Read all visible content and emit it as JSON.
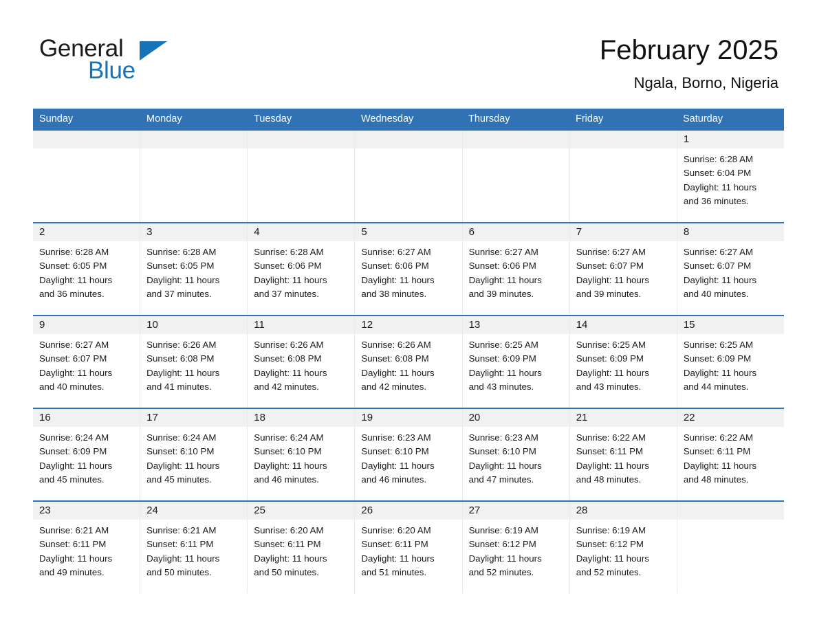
{
  "brand": {
    "name_part1": "General",
    "name_part2": "Blue",
    "triangle_color": "#1673b8"
  },
  "header": {
    "title": "February 2025",
    "subtitle": "Ngala, Borno, Nigeria"
  },
  "colors": {
    "header_blue": "#3072b4",
    "daynum_band": "#f1f1f1",
    "text": "#1b1b1b"
  },
  "weekday_headers": [
    "Sunday",
    "Monday",
    "Tuesday",
    "Wednesday",
    "Thursday",
    "Friday",
    "Saturday"
  ],
  "weeks": [
    [
      {
        "day": "",
        "lines": []
      },
      {
        "day": "",
        "lines": []
      },
      {
        "day": "",
        "lines": []
      },
      {
        "day": "",
        "lines": []
      },
      {
        "day": "",
        "lines": []
      },
      {
        "day": "",
        "lines": []
      },
      {
        "day": "1",
        "lines": [
          "Sunrise: 6:28 AM",
          "Sunset: 6:04 PM",
          "Daylight: 11 hours",
          "and 36 minutes."
        ]
      }
    ],
    [
      {
        "day": "2",
        "lines": [
          "Sunrise: 6:28 AM",
          "Sunset: 6:05 PM",
          "Daylight: 11 hours",
          "and 36 minutes."
        ]
      },
      {
        "day": "3",
        "lines": [
          "Sunrise: 6:28 AM",
          "Sunset: 6:05 PM",
          "Daylight: 11 hours",
          "and 37 minutes."
        ]
      },
      {
        "day": "4",
        "lines": [
          "Sunrise: 6:28 AM",
          "Sunset: 6:06 PM",
          "Daylight: 11 hours",
          "and 37 minutes."
        ]
      },
      {
        "day": "5",
        "lines": [
          "Sunrise: 6:27 AM",
          "Sunset: 6:06 PM",
          "Daylight: 11 hours",
          "and 38 minutes."
        ]
      },
      {
        "day": "6",
        "lines": [
          "Sunrise: 6:27 AM",
          "Sunset: 6:06 PM",
          "Daylight: 11 hours",
          "and 39 minutes."
        ]
      },
      {
        "day": "7",
        "lines": [
          "Sunrise: 6:27 AM",
          "Sunset: 6:07 PM",
          "Daylight: 11 hours",
          "and 39 minutes."
        ]
      },
      {
        "day": "8",
        "lines": [
          "Sunrise: 6:27 AM",
          "Sunset: 6:07 PM",
          "Daylight: 11 hours",
          "and 40 minutes."
        ]
      }
    ],
    [
      {
        "day": "9",
        "lines": [
          "Sunrise: 6:27 AM",
          "Sunset: 6:07 PM",
          "Daylight: 11 hours",
          "and 40 minutes."
        ]
      },
      {
        "day": "10",
        "lines": [
          "Sunrise: 6:26 AM",
          "Sunset: 6:08 PM",
          "Daylight: 11 hours",
          "and 41 minutes."
        ]
      },
      {
        "day": "11",
        "lines": [
          "Sunrise: 6:26 AM",
          "Sunset: 6:08 PM",
          "Daylight: 11 hours",
          "and 42 minutes."
        ]
      },
      {
        "day": "12",
        "lines": [
          "Sunrise: 6:26 AM",
          "Sunset: 6:08 PM",
          "Daylight: 11 hours",
          "and 42 minutes."
        ]
      },
      {
        "day": "13",
        "lines": [
          "Sunrise: 6:25 AM",
          "Sunset: 6:09 PM",
          "Daylight: 11 hours",
          "and 43 minutes."
        ]
      },
      {
        "day": "14",
        "lines": [
          "Sunrise: 6:25 AM",
          "Sunset: 6:09 PM",
          "Daylight: 11 hours",
          "and 43 minutes."
        ]
      },
      {
        "day": "15",
        "lines": [
          "Sunrise: 6:25 AM",
          "Sunset: 6:09 PM",
          "Daylight: 11 hours",
          "and 44 minutes."
        ]
      }
    ],
    [
      {
        "day": "16",
        "lines": [
          "Sunrise: 6:24 AM",
          "Sunset: 6:09 PM",
          "Daylight: 11 hours",
          "and 45 minutes."
        ]
      },
      {
        "day": "17",
        "lines": [
          "Sunrise: 6:24 AM",
          "Sunset: 6:10 PM",
          "Daylight: 11 hours",
          "and 45 minutes."
        ]
      },
      {
        "day": "18",
        "lines": [
          "Sunrise: 6:24 AM",
          "Sunset: 6:10 PM",
          "Daylight: 11 hours",
          "and 46 minutes."
        ]
      },
      {
        "day": "19",
        "lines": [
          "Sunrise: 6:23 AM",
          "Sunset: 6:10 PM",
          "Daylight: 11 hours",
          "and 46 minutes."
        ]
      },
      {
        "day": "20",
        "lines": [
          "Sunrise: 6:23 AM",
          "Sunset: 6:10 PM",
          "Daylight: 11 hours",
          "and 47 minutes."
        ]
      },
      {
        "day": "21",
        "lines": [
          "Sunrise: 6:22 AM",
          "Sunset: 6:11 PM",
          "Daylight: 11 hours",
          "and 48 minutes."
        ]
      },
      {
        "day": "22",
        "lines": [
          "Sunrise: 6:22 AM",
          "Sunset: 6:11 PM",
          "Daylight: 11 hours",
          "and 48 minutes."
        ]
      }
    ],
    [
      {
        "day": "23",
        "lines": [
          "Sunrise: 6:21 AM",
          "Sunset: 6:11 PM",
          "Daylight: 11 hours",
          "and 49 minutes."
        ]
      },
      {
        "day": "24",
        "lines": [
          "Sunrise: 6:21 AM",
          "Sunset: 6:11 PM",
          "Daylight: 11 hours",
          "and 50 minutes."
        ]
      },
      {
        "day": "25",
        "lines": [
          "Sunrise: 6:20 AM",
          "Sunset: 6:11 PM",
          "Daylight: 11 hours",
          "and 50 minutes."
        ]
      },
      {
        "day": "26",
        "lines": [
          "Sunrise: 6:20 AM",
          "Sunset: 6:11 PM",
          "Daylight: 11 hours",
          "and 51 minutes."
        ]
      },
      {
        "day": "27",
        "lines": [
          "Sunrise: 6:19 AM",
          "Sunset: 6:12 PM",
          "Daylight: 11 hours",
          "and 52 minutes."
        ]
      },
      {
        "day": "28",
        "lines": [
          "Sunrise: 6:19 AM",
          "Sunset: 6:12 PM",
          "Daylight: 11 hours",
          "and 52 minutes."
        ]
      },
      {
        "day": "",
        "lines": []
      }
    ]
  ]
}
